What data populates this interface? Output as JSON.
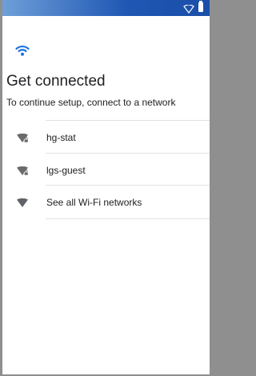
{
  "colors": {
    "accent": "#1a73e8",
    "status_bar": "#1f57b4",
    "text": "#202124",
    "icon": "#5f6368",
    "divider": "#e2e2e2"
  },
  "status_bar": {
    "icons": [
      "wifi-outline-icon",
      "battery-icon"
    ]
  },
  "header": {
    "icon": "wifi-icon",
    "title": "Get connected",
    "subtitle": "To continue setup, connect to a network"
  },
  "networks": [
    {
      "name": "hg-stat",
      "icon": "wifi-locked-icon",
      "secured": true
    },
    {
      "name": "lgs-guest",
      "icon": "wifi-locked-icon",
      "secured": true
    }
  ],
  "see_all": {
    "label": "See all Wi-Fi networks",
    "icon": "wifi-icon"
  }
}
